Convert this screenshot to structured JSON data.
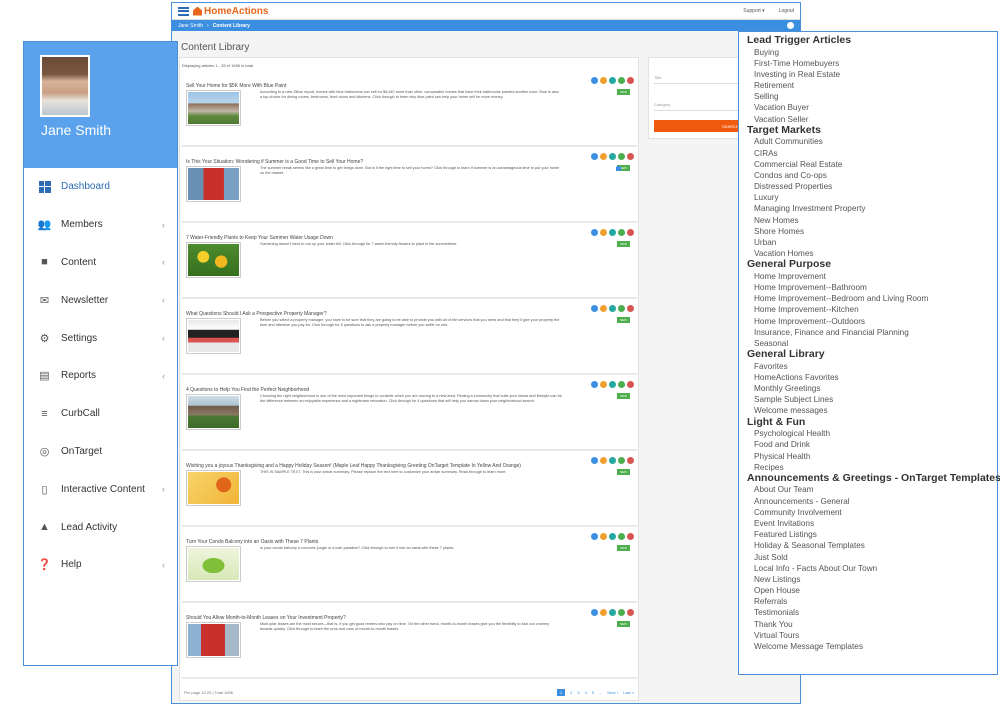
{
  "app": {
    "logo_text": "HomeActions",
    "top_links": [
      "Support ▾",
      "Logout"
    ],
    "breadcrumb": [
      "Jane Smith",
      "Content Library"
    ],
    "page_title": "Content Library",
    "displaying": "Displaying articles 1 - 25 of 1696 in total"
  },
  "articles": [
    {
      "title": "Sell Your Home for $5K More With Blue Paint",
      "badge": "NEW",
      "summary": "According to a new Zillow report, homes with blue bathrooms can sell for $5,440 more than other, comparable homes that have their bathrooms painted another color. Blue is also a top choice for dining rooms, bedrooms, front doors and kitchens. Click through to learn why blue paint can help your home sell for more money.",
      "thumb": "house-photo"
    },
    {
      "title": "Is This Your Situation: Wondering if Summer is a Good Time to Sell Your Home?",
      "badge": "NEW",
      "summary": "The summer break seems like a great time to get things done. But is it the right time to sell your home? Click through to learn if summer is an advantageous time to put your home on the market.",
      "thumb": "for-sale-sign-photo"
    },
    {
      "title": "7 Water-Friendly Plants to Keep Your Summer Water Usage Down",
      "badge": "NEW",
      "summary": "Gardening doesn't have to run up your water bill. Click through for 7 water-friendly flowers to plant in the summertime.",
      "thumb": "flowers-photo"
    },
    {
      "title": "What Questions Should I Ask a Prospective Property Manager?",
      "badge": "NEW",
      "summary": "Before you select a property manager, you have to be sure that they are going to be able to provide you with all of the services that you need and that they'll give your property the time and attention you pay for. Click through for 5 questions to ask a property manager before you settle on one.",
      "thumb": "property-management-photo"
    },
    {
      "title": "4 Questions to Help You Find the Perfect Neighborhood",
      "badge": "NEW",
      "summary": "Choosing the right neighborhood is one of the most important things to consider when you are moving to a new area. Finding a community that suits your needs and lifestyle can be the difference between an enjoyable experience and a nightmare relocation. Click through for 4 questions that will help you narrow down your neighborhood search.",
      "thumb": "neighborhood-photo"
    },
    {
      "title": "Wishing you a joyous Thanksgiving and a Happy Holiday Season! (Maple Leaf Happy Thanksgiving Greeting OnTarget Template In Yellow And Orange)",
      "badge": "NEW",
      "summary": "THIS IS SAMPLE TEXT. This is your article summary. Please replace the text here to customize your article summary. Read through to learn more.",
      "thumb": "thanksgiving-card"
    },
    {
      "title": "Turn Your Condo Balcony into an Oasis with These 7 Plants",
      "badge": "NEW",
      "summary": "Is your condo balcony a concrete jungle or a lush paradise? Click through to turn it into an oasis with these 7 plants.",
      "thumb": "balcony-plants-photo"
    },
    {
      "title": "Should You Allow Month-to-Month Leases on Your Investment Property?",
      "badge": "NEW",
      "summary": "Multi-year leases are the most secure—that is, if you get good renters who pay on time. On the other hand, month-to-month leases give you the flexibility to kick out crummy tenants quickly. Click through to learn the pros and cons of month-to-month leases.",
      "thumb": "for-rent-sign-photo"
    }
  ],
  "pager": {
    "per_page": "Per page 10 25 | Total 1696",
    "pages": [
      "1",
      "2",
      "3",
      "4",
      "5",
      "...",
      "Next ›",
      "Last »"
    ]
  },
  "filter": {
    "title_label": "Title",
    "category_label": "Category",
    "search_label": "SEARCH"
  },
  "sidebar": {
    "user_name": "Jane Smith",
    "items": [
      {
        "label": "Dashboard",
        "icon": "dashboard-icon",
        "chevron": false,
        "active": true
      },
      {
        "label": "Members",
        "icon": "members-icon",
        "chevron": true
      },
      {
        "label": "Content",
        "icon": "book-icon",
        "chevron": true
      },
      {
        "label": "Newsletter",
        "icon": "envelope-icon",
        "chevron": true
      },
      {
        "label": "Settings",
        "icon": "gear-icon",
        "chevron": true
      },
      {
        "label": "Reports",
        "icon": "bar-chart-icon",
        "chevron": true
      },
      {
        "label": "CurbCall",
        "icon": "wifi-icon",
        "chevron": false
      },
      {
        "label": "OnTarget",
        "icon": "target-icon",
        "chevron": false
      },
      {
        "label": "Interactive Content",
        "icon": "mouse-icon",
        "chevron": true
      },
      {
        "label": "Lead Activity",
        "icon": "bell-icon",
        "chevron": false
      },
      {
        "label": "Help",
        "icon": "help-icon",
        "chevron": true
      }
    ]
  },
  "categories": [
    {
      "heading": "Lead Trigger Articles",
      "items": [
        "Buying",
        "First-Time Homebuyers",
        "Investing in Real Estate",
        "Retirement",
        "Selling",
        "Vacation Buyer",
        "Vacation Seller"
      ]
    },
    {
      "heading": "Target Markets",
      "items": [
        "Adult Communities",
        "CIRAs",
        "Commercial Real Estate",
        "Condos and Co-ops",
        "Distressed Properties",
        "Luxury",
        "Managing Investment Property",
        "New Homes",
        "Shore Homes",
        "Urban",
        "Vacation Homes"
      ]
    },
    {
      "heading": "General Purpose",
      "items": [
        "Home Improvement",
        "Home Improvement--Bathroom",
        "Home Improvement--Bedroom and Living Room",
        "Home Improvement--Kitchen",
        "Home Improvement--Outdoors",
        "Insurance, Finance and Financial Planning",
        "Seasonal"
      ]
    },
    {
      "heading": "General Library",
      "items": [
        "Favorites",
        "HomeActions Favorites",
        "Monthly Greetings",
        "Sample Subject Lines",
        "Welcome messages"
      ]
    },
    {
      "heading": "Light & Fun",
      "items": [
        "Psychological Health",
        "Food and Drink",
        "Physical Health",
        "Recipes"
      ]
    },
    {
      "heading": "Announcements & Greetings - OnTarget Templates",
      "items": [
        "About Our Team",
        "Announcements - General",
        "Community Involvement",
        "Event Invitations",
        "Featured Listings",
        "Holiday & Seasonal Templates",
        "Just Sold",
        "Local Info - Facts About Our Town",
        "New Listings",
        "Open House",
        "Referrals",
        "Testimonials",
        "Thank You",
        "Virtual Tours",
        "Welcome Message Templates"
      ]
    }
  ],
  "colors": {
    "primary": "#3c8fe0",
    "accent": "#f05a0e",
    "badge": "#4cae4c",
    "sidebar_header": "#5aa2ec"
  }
}
